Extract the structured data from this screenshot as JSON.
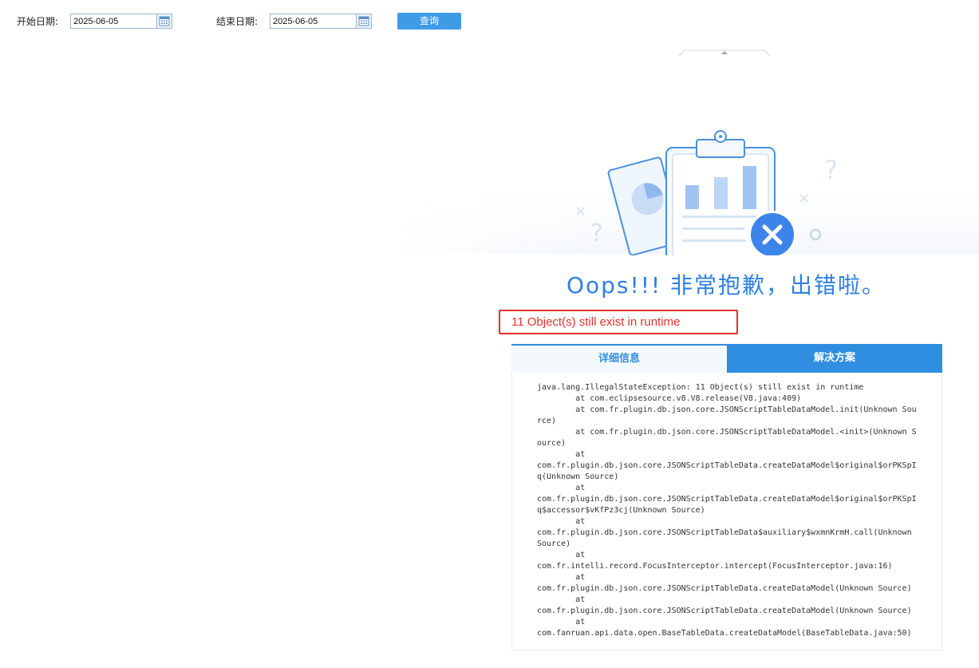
{
  "filters": {
    "start_label": "开始日期:",
    "start_value": "2025-06-05",
    "end_label": "结束日期:",
    "end_value": "2025-06-05",
    "query_label": "查询"
  },
  "icons": {
    "calendar": "calendar-icon",
    "collapse": "chevron-up-icon",
    "error": "close-icon"
  },
  "error": {
    "title": "Oops!!! 非常抱歉，出错啦。",
    "message": "11 Object(s) still exist in runtime",
    "tabs": [
      {
        "label": "详细信息",
        "active": true
      },
      {
        "label": "解决方案",
        "active": false
      }
    ],
    "stack_trace": "java.lang.IllegalStateException: 11 Object(s) still exist in runtime\n        at com.eclipsesource.v8.V8.release(V8.java:409)\n        at com.fr.plugin.db.json.core.JSONScriptTableDataModel.init(Unknown Source)\n        at com.fr.plugin.db.json.core.JSONScriptTableDataModel.<init>(Unknown Source)\n        at\ncom.fr.plugin.db.json.core.JSONScriptTableData.createDataModel$original$orPKSpIq(Unknown Source)\n        at\ncom.fr.plugin.db.json.core.JSONScriptTableData.createDataModel$original$orPKSpIq$accessor$vKfPz3cj(Unknown Source)\n        at\ncom.fr.plugin.db.json.core.JSONScriptTableData$auxiliary$wxmnKrmH.call(Unknown Source)\n        at\ncom.fr.intelli.record.FocusInterceptor.intercept(FocusInterceptor.java:16)\n        at\ncom.fr.plugin.db.json.core.JSONScriptTableData.createDataModel(Unknown Source)\n        at\ncom.fr.plugin.db.json.core.JSONScriptTableData.createDataModel(Unknown Source)\n        at\ncom.fanruan.api.data.open.BaseTableData.createDataModel(BaseTableData.java:50)"
  },
  "colors": {
    "accent": "#2f8ee0",
    "title": "#2f7fe0",
    "error": "#e0322f",
    "button": "#3e9be6"
  }
}
